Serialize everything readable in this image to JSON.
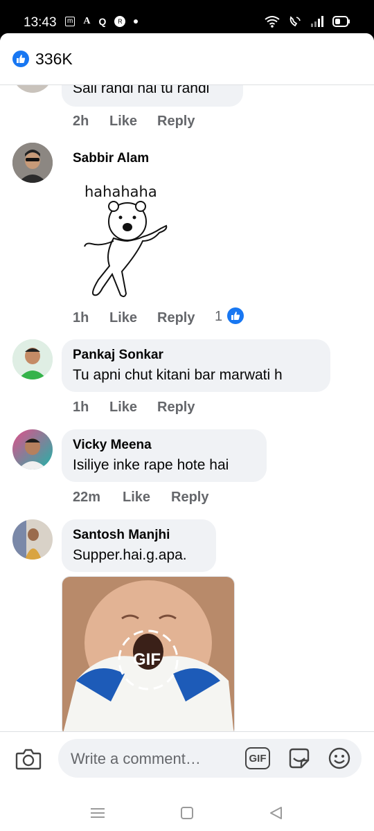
{
  "status": {
    "time": "13:43",
    "small_icons": [
      "m",
      "A",
      "Q",
      "R"
    ]
  },
  "header": {
    "reaction_count": "336K"
  },
  "comments": [
    {
      "name": "",
      "text": "Sali randi hai tu randi",
      "time": "2h",
      "like": "Like",
      "reply": "Reply"
    },
    {
      "name": "Sabbir Alam",
      "sticker_text": "hahahaha",
      "time": "1h",
      "like": "Like",
      "reply": "Reply",
      "like_count": "1"
    },
    {
      "name": "Pankaj Sonkar",
      "text": "Tu apni chut kitani bar marwati h",
      "time": "1h",
      "like": "Like",
      "reply": "Reply"
    },
    {
      "name": "Vicky Meena",
      "text": "Isiliye inke rape hote hai",
      "time": "22m",
      "like": "Like",
      "reply": "Reply"
    },
    {
      "name": "Santosh Manjhi",
      "text": "Supper.hai.g.apa.",
      "gif_label": "GIF"
    }
  ],
  "composer": {
    "placeholder": "Write a comment…",
    "gif_button": "GIF"
  },
  "icons": {
    "like": "thumbs-up-icon",
    "camera": "camera-icon",
    "gif": "gif-icon",
    "sticker": "sticker-icon",
    "emoji": "emoji-icon",
    "nav": [
      "menu-icon",
      "home-square-icon",
      "back-triangle-icon"
    ]
  },
  "colors": {
    "accent": "#1877f2",
    "bubble": "#f0f2f5",
    "meta": "#65676b"
  }
}
